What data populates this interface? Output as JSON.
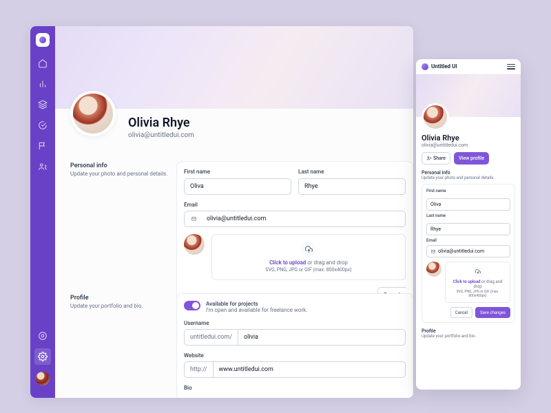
{
  "app_name": "Untitled UI",
  "user": {
    "name": "Olivia Rhye",
    "email": "olivia@untitledui.com"
  },
  "sections": {
    "personal": {
      "title": "Personal info",
      "desc": "Update your photo and personal details."
    },
    "profile": {
      "title": "Profile",
      "desc": "Update your portfolio and bio."
    }
  },
  "fields": {
    "first_name": {
      "label": "First name",
      "value": "Oliva"
    },
    "last_name": {
      "label": "Last name",
      "value": "Rhye"
    },
    "email": {
      "label": "Email",
      "value": "olivia@untitledui.com"
    },
    "username": {
      "label": "Username",
      "prefix": "untitledui.com/",
      "value": "olivia"
    },
    "website": {
      "label": "Website",
      "prefix": "http://",
      "value": "www.untitledui.com"
    },
    "bio": {
      "label": "Bio"
    }
  },
  "upload": {
    "link": "Click to upload",
    "rest": " or drag and drop",
    "sub": "SVG, PNG, JPG or GIF (max. 800x400px)"
  },
  "toggle": {
    "title": "Available for projects",
    "desc": "I'm open and available for freelance work."
  },
  "buttons": {
    "cancel": "Cancel",
    "save": "Save changes",
    "share": "Share",
    "view_profile": "View profile"
  }
}
